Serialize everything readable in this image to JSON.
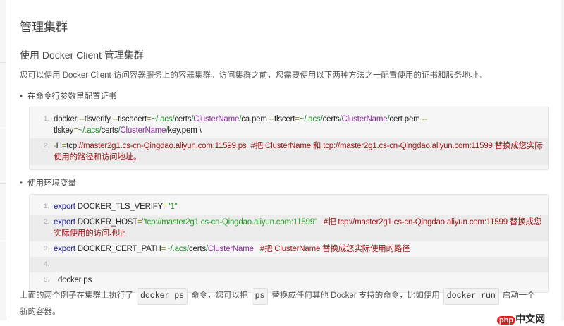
{
  "title": "管理集群",
  "subtitle": "使用 Docker Client 管理集群",
  "intro": "您可以使用 Docker Client 访问容器服务上的容器集群。访问集群之前，您需要使用以下两种方法之一配置使用的证书和服务地址。",
  "bullet1": "在命令行参数里配置证书",
  "bullet2": "使用环境变量",
  "code1": [
    {
      "num": "1.",
      "tokens": [
        [
          "pl",
          "docker "
        ],
        [
          "op",
          "--"
        ],
        [
          "pl",
          "tlsverify "
        ],
        [
          "op",
          "--"
        ],
        [
          "pl",
          "tlscacert"
        ],
        [
          "op",
          "="
        ],
        [
          "path",
          "~/.acs/"
        ],
        [
          "pl",
          "certs"
        ],
        [
          "path",
          "/"
        ],
        [
          "name",
          "ClusterName"
        ],
        [
          "path",
          "/"
        ],
        [
          "pl",
          "ca.pem "
        ],
        [
          "op",
          "--"
        ],
        [
          "pl",
          "tlscert"
        ],
        [
          "op",
          "="
        ],
        [
          "path",
          "~/.acs/"
        ],
        [
          "pl",
          "certs"
        ],
        [
          "path",
          "/"
        ],
        [
          "name",
          "ClusterName"
        ],
        [
          "path",
          "/"
        ],
        [
          "pl",
          "cert.pem "
        ],
        [
          "op",
          "--"
        ],
        [
          "pl",
          " tlskey"
        ],
        [
          "op",
          "="
        ],
        [
          "path",
          "~/.acs/"
        ],
        [
          "pl",
          "certs"
        ],
        [
          "path",
          "/"
        ],
        [
          "name",
          "ClusterName"
        ],
        [
          "path",
          "/"
        ],
        [
          "pl",
          "key.pem \\"
        ]
      ]
    },
    {
      "num": "2.",
      "tokens": [
        [
          "op",
          "-"
        ],
        [
          "pl",
          "H"
        ],
        [
          "op",
          "="
        ],
        [
          "pl",
          "tcp"
        ],
        [
          "cm",
          "://master2g1.cs-cn-Qingdao.aliyun.com:11599 ps  #把 ClusterName 和 tcp://master2g1.cs-cn-Qingdao.aliyun.com:11599 替换成您实际使用的路径和访问地址。"
        ]
      ]
    }
  ],
  "code2": [
    {
      "num": "1.",
      "tokens": [
        [
          "kw",
          "export "
        ],
        [
          "pl",
          "DOCKER_TLS_VERIFY"
        ],
        [
          "op",
          "="
        ],
        [
          "str",
          "\"1\""
        ]
      ]
    },
    {
      "num": "2.",
      "tokens": [
        [
          "kw",
          "export "
        ],
        [
          "pl",
          "DOCKER_HOST"
        ],
        [
          "op",
          "="
        ],
        [
          "str",
          "\"tcp://master2g1.cs-cn-Qingdao.aliyun.com:11599\"   "
        ],
        [
          "cm",
          "#把 tcp://master2g1.cs-cn-Qingdao.aliyun.com:11599 替换成您实际使用的访问地址"
        ]
      ]
    },
    {
      "num": "3.",
      "tokens": [
        [
          "kw",
          "export "
        ],
        [
          "pl",
          "DOCKER_CERT_PATH"
        ],
        [
          "op",
          "="
        ],
        [
          "path",
          "~/.acs/"
        ],
        [
          "pl",
          "certs"
        ],
        [
          "path",
          "/"
        ],
        [
          "name",
          "ClusterName"
        ],
        [
          "cm",
          "   #把 ClusterName 替换成您实际使用的路径"
        ]
      ]
    },
    {
      "num": "4.",
      "tokens": [
        [
          "pl",
          " "
        ]
      ]
    },
    {
      "num": "5.",
      "tokens": [
        [
          "pl",
          "  docker ps"
        ]
      ]
    }
  ],
  "outro": {
    "a": "上面的两个例子在集群上执行了",
    "c1": "docker ps",
    "b": "命令，您可以把",
    "c2": "ps",
    "c": "替换成任何其他 Docker 支持的命令，比如使用",
    "c3": "docker run",
    "d": "启动一个新的容器。"
  },
  "watermark": "php中文网"
}
